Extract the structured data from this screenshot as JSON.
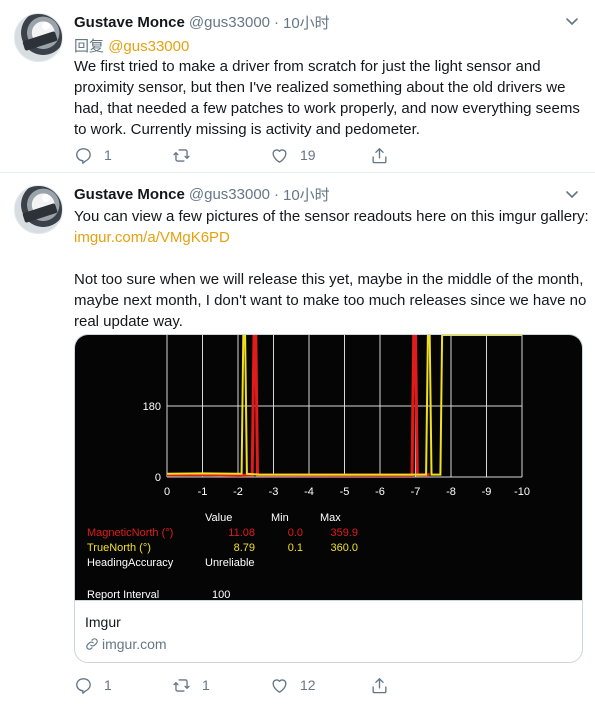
{
  "tweets": [
    {
      "name": "Gustave Monce",
      "handle": "@gus33000",
      "dot": "·",
      "time": "10小时",
      "reply_prefix": "回复",
      "reply_mention": "@gus33000",
      "text": "We first tried to make a driver from scratch for just the light sensor and proximity sensor, but then I've realized something about the old drivers we had, that needed a few patches to work properly, and now everything seems to work. Currently missing is activity and pedometer.",
      "replies": "1",
      "retweets": "",
      "likes": "19"
    },
    {
      "name": "Gustave Monce",
      "handle": "@gus33000",
      "dot": "·",
      "time": "10小时",
      "text_line1": "You can view a few pictures of the sensor readouts here on this imgur gallery:",
      "link": "imgur.com/a/VMgK6PD",
      "text_para2": "Not too sure when we will release this yet, maybe in the middle of the month, maybe next month, I don't want to make too much releases since we have no real update way.",
      "replies": "1",
      "retweets": "1",
      "likes": "12",
      "card": {
        "title": "Imgur",
        "domain": "imgur.com"
      }
    }
  ],
  "chart_data": {
    "type": "line",
    "x_ticks": [
      "0",
      "-1",
      "-2",
      "-3",
      "-4",
      "-5",
      "-6",
      "-7",
      "-8",
      "-9",
      "-10"
    ],
    "y_ticks": [
      "0",
      "180"
    ],
    "xlim": [
      0,
      -10
    ],
    "ylim": [
      0,
      360
    ],
    "series": [
      {
        "color": "#e01b1b",
        "points": [
          [
            0,
            5
          ],
          [
            -1,
            6
          ],
          [
            -2,
            4
          ],
          [
            -2.4,
            5
          ],
          [
            -2.45,
            360
          ],
          [
            -2.5,
            360
          ],
          [
            -2.55,
            5
          ],
          [
            -6.9,
            4
          ],
          [
            -6.95,
            360
          ],
          [
            -7.0,
            360
          ],
          [
            -7.05,
            5
          ],
          [
            -7.4,
            6
          ]
        ]
      },
      {
        "color": "#f0e020",
        "points": [
          [
            0,
            8
          ],
          [
            -1,
            9
          ],
          [
            -2,
            8
          ],
          [
            -2.1,
            8
          ],
          [
            -2.15,
            360
          ],
          [
            -2.2,
            360
          ],
          [
            -2.25,
            8
          ],
          [
            -2.6,
            6
          ],
          [
            -7.3,
            6
          ],
          [
            -7.35,
            360
          ],
          [
            -7.4,
            360
          ],
          [
            -7.45,
            6
          ],
          [
            -7.7,
            6
          ],
          [
            -7.75,
            360
          ],
          [
            -10,
            360
          ]
        ]
      }
    ],
    "table": {
      "headers": [
        "",
        "Value",
        "Min",
        "Max"
      ],
      "rows": [
        {
          "label": "MagneticNorth (°)",
          "value": "11.08",
          "min": "0.0",
          "max": "359.9",
          "color": "#e01b1b"
        },
        {
          "label": "TrueNorth (°)",
          "value": "8.79",
          "min": "0.1",
          "max": "360.0",
          "color": "#f0e020"
        },
        {
          "label": "HeadingAccuracy",
          "value": "Unreliable",
          "min": "",
          "max": "",
          "color": "#ffffff"
        }
      ],
      "report_interval_label": "Report Interval",
      "report_interval_value": "100"
    }
  }
}
